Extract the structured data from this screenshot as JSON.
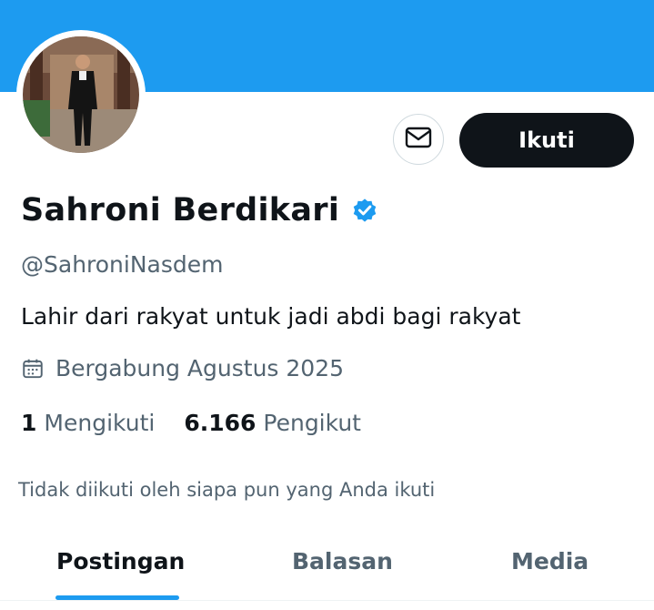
{
  "profile": {
    "display_name": "Sahroni Berdikari",
    "handle": "@SahroniNasdem",
    "bio": "Lahir dari rakyat untuk jadi abdi bagi rakyat",
    "joined": "Bergabung Agustus 2025",
    "verified": true
  },
  "stats": {
    "following_count": "1",
    "following_label": "Mengikuti",
    "followers_count": "6.166",
    "followers_label": "Pengikut"
  },
  "mutual_text": "Tidak diikuti oleh siapa pun yang Anda ikuti",
  "actions": {
    "follow_label": "Ikuti",
    "message_icon": "envelope-icon"
  },
  "tabs": [
    {
      "label": "Postingan",
      "active": true
    },
    {
      "label": "Balasan",
      "active": false
    },
    {
      "label": "Media",
      "active": false
    }
  ],
  "colors": {
    "banner": "#1d9bf0",
    "accent": "#1d9bf0",
    "primary_text": "#0f1419",
    "secondary_text": "#536471",
    "follow_button": "#0f1419"
  }
}
